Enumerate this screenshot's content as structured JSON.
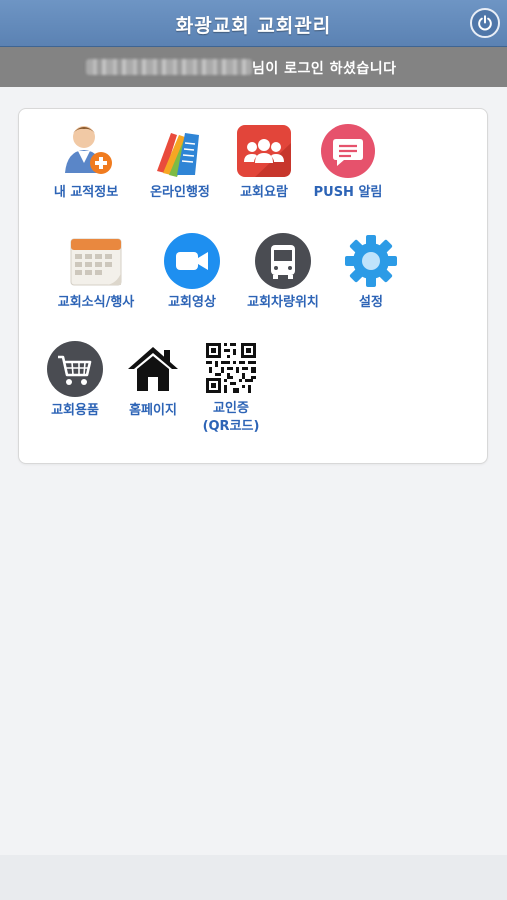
{
  "header": {
    "title": "화광교회 교회관리"
  },
  "login_bar": {
    "message": "님이 로그인 하셨습니다"
  },
  "menu": [
    {
      "label": "내 교적정보",
      "icon": "user-add-icon"
    },
    {
      "label": "온라인행정",
      "icon": "documents-icon"
    },
    {
      "label": "교회요람",
      "icon": "people-group-icon"
    },
    {
      "label": "PUSH 알림",
      "icon": "chat-bubble-icon"
    },
    {
      "label": "교회소식/행사",
      "icon": "calendar-icon"
    },
    {
      "label": "교회영상",
      "icon": "video-camera-icon"
    },
    {
      "label": "교회차량위치",
      "icon": "bus-icon"
    },
    {
      "label": "설정",
      "icon": "gear-icon"
    },
    {
      "label": "교회용품",
      "icon": "shopping-cart-icon"
    },
    {
      "label": "홈페이지",
      "icon": "home-icon"
    },
    {
      "label": "교인증",
      "label2": "(QR코드)",
      "icon": "qr-code-icon"
    }
  ],
  "colors": {
    "header": "#5b82b3",
    "login_bar": "#838383",
    "label": "#2d64b6"
  }
}
